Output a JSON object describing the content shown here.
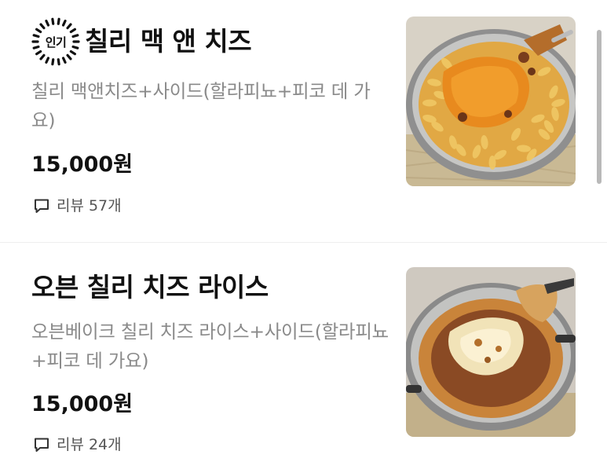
{
  "menu": {
    "items": [
      {
        "badge": "인기",
        "title": "칠리 맥 앤 치즈",
        "description": "칠리 맥앤치즈+사이드(할라피뇨+피코 데 가요)",
        "price": "15,000원",
        "review_label": "리뷰",
        "review_count": "57개",
        "image_icon": "chili-mac-and-cheese-photo"
      },
      {
        "title": "오븐 칠리 치즈 라이스",
        "description": "오븐베이크 칠리 치즈 라이스+사이드(할라피뇨+피코 데 가요)",
        "price": "15,000원",
        "review_label": "리뷰",
        "review_count": "24개",
        "image_icon": "oven-chili-cheese-rice-photo"
      }
    ]
  },
  "colors": {
    "title": "#111111",
    "description": "#8a8a8a",
    "review": "#555555",
    "divider": "#eeeeee",
    "scrollbar": "#b9b9b9"
  }
}
